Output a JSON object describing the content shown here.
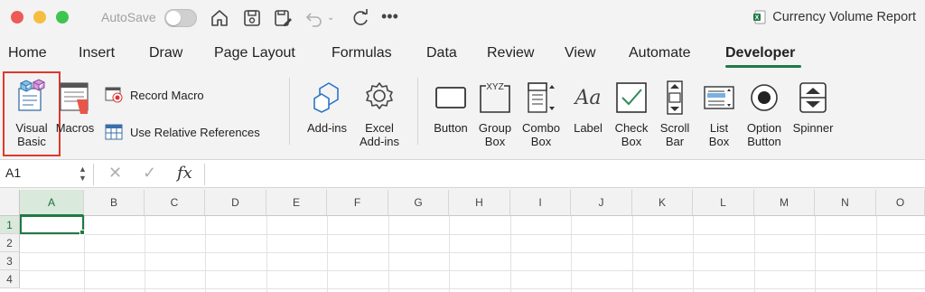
{
  "titlebar": {
    "autosave_label": "AutoSave",
    "document_title": "Currency Volume Report"
  },
  "tabs": [
    "Home",
    "Insert",
    "Draw",
    "Page Layout",
    "Formulas",
    "Data",
    "Review",
    "View",
    "Automate",
    "Developer"
  ],
  "active_tab": "Developer",
  "ribbon": {
    "visual_basic": "Visual Basic",
    "macros": "Macros",
    "record_macro": "Record Macro",
    "use_relative_references": "Use Relative References",
    "add_ins": "Add-ins",
    "excel_add_ins": "Excel Add-ins",
    "button": "Button",
    "group_box": "Group Box",
    "combo_box": "Combo Box",
    "label": "Label",
    "check_box": "Check Box",
    "scroll_bar": "Scroll Bar",
    "list_box": "List Box",
    "option_button": "Option Button",
    "spinner": "Spinner",
    "group_box_icon_text": "XYZ",
    "label_icon_text": "Aa"
  },
  "formula_bar": {
    "name_box": "A1",
    "fx": "fx",
    "formula": ""
  },
  "sheet": {
    "columns": [
      "A",
      "B",
      "C",
      "D",
      "E",
      "F",
      "G",
      "H",
      "I",
      "J",
      "K",
      "L",
      "M",
      "N",
      "O"
    ],
    "rows": [
      "1",
      "2",
      "3",
      "4"
    ],
    "selected_cell": "A1"
  },
  "colors": {
    "accent": "#1f7a44",
    "highlight": "#e0382c"
  }
}
